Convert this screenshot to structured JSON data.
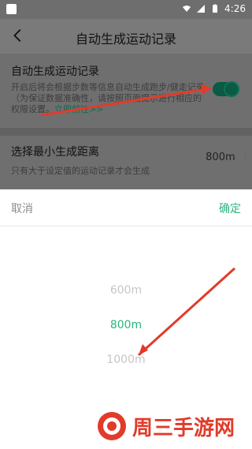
{
  "status": {
    "time": "4:26"
  },
  "header": {
    "title": "自动生成运动记录"
  },
  "item1": {
    "title": "自动生成运动记录",
    "desc_main": "开启后将会根据步数等信息自动生成跑步/健走记录（为保证数据准确性，请按照页面提示进行相应的权限设置。",
    "desc_link": "立即前往>>"
  },
  "item2": {
    "title": "选择最小生成距离",
    "desc": "只有大于设定值的运动记录才会生成",
    "value": "800m"
  },
  "sheet": {
    "cancel": "取消",
    "confirm": "确定",
    "options": [
      "600m",
      "800m",
      "1000m"
    ],
    "selected_index": 1
  },
  "watermark": {
    "text": "周三手游网"
  },
  "colors": {
    "accent": "#2bb580",
    "arrow": "#e23b2a"
  }
}
